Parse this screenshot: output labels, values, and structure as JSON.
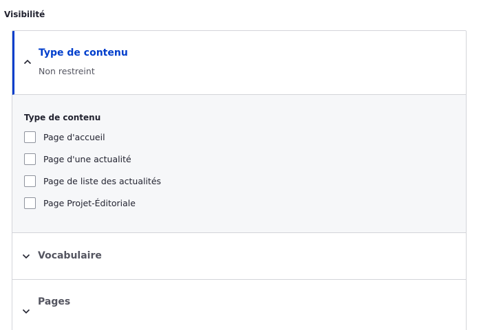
{
  "section": {
    "title": "Visibilité"
  },
  "content_type_tab": {
    "title": "Type de contenu",
    "summary": "Non restreint",
    "expanded": true,
    "accent_color": "#003ecc"
  },
  "content_type_pane": {
    "label": "Type de contenu",
    "options": [
      {
        "label": "Page d'accueil",
        "checked": false
      },
      {
        "label": "Page d'une actualité",
        "checked": false
      },
      {
        "label": "Page de liste des actualités",
        "checked": false
      },
      {
        "label": "Page Projet-Éditoriale",
        "checked": false
      }
    ]
  },
  "vocabulary_tab": {
    "title": "Vocabulaire",
    "expanded": false
  },
  "pages_tab": {
    "title": "Pages",
    "expanded": false
  },
  "icons": {
    "expanded": "chevron-up-icon",
    "collapsed": "chevron-down-icon"
  }
}
